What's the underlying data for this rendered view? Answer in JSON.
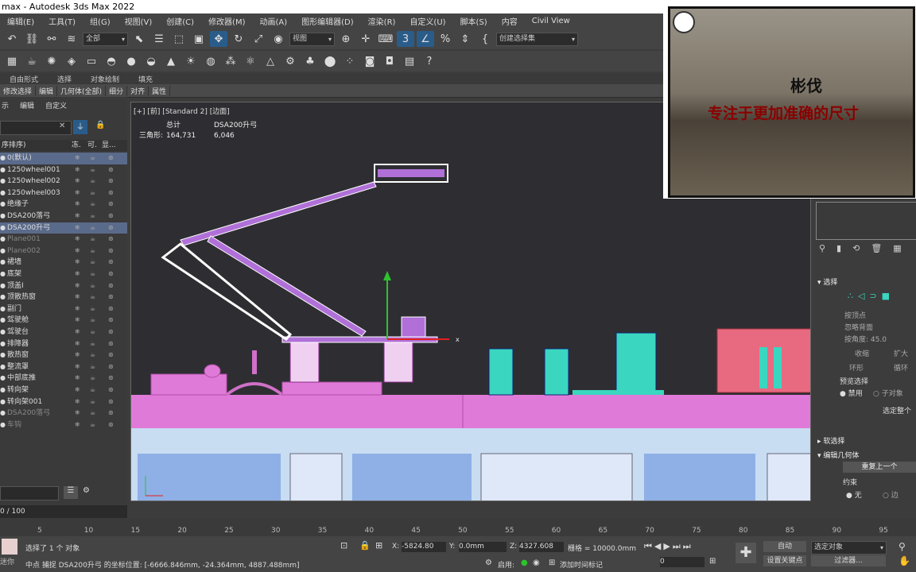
{
  "window": {
    "title": "max - Autodesk 3ds Max 2022"
  },
  "menu": [
    "编辑(E)",
    "工具(T)",
    "组(G)",
    "视图(V)",
    "创建(C)",
    "修改器(M)",
    "动画(A)",
    "图形编辑器(D)",
    "渲染(R)",
    "自定义(U)",
    "脚本(S)",
    "内容",
    "Civil View"
  ],
  "toolbar1": {
    "filter": "全部",
    "refcoord": "视图",
    "selset": "创建选择集"
  },
  "ribbon": {
    "tabs": [
      "自由形式",
      "选择",
      "对象绘制",
      "填充"
    ],
    "sub": [
      "修改选择",
      "编辑",
      "几何体(全部)",
      "细分",
      "对齐",
      "属性"
    ]
  },
  "scene": {
    "tabs": [
      "示",
      "编辑",
      "自定义"
    ],
    "col_name": "序排序)",
    "col_icons": [
      "冻.",
      "可.",
      "显..."
    ],
    "rows": [
      {
        "name": "0(默认)",
        "sel": true
      },
      {
        "name": "1250wheel001"
      },
      {
        "name": "1250wheel002"
      },
      {
        "name": "1250wheel003"
      },
      {
        "name": "绝缘子"
      },
      {
        "name": "DSA200落弓"
      },
      {
        "name": "DSA200升弓",
        "sel": true
      },
      {
        "name": "Plane001",
        "dim": true
      },
      {
        "name": "Plane002",
        "dim": true
      },
      {
        "name": "裙墙"
      },
      {
        "name": "底架"
      },
      {
        "name": "顶盖I"
      },
      {
        "name": "顶散热窗"
      },
      {
        "name": "副门"
      },
      {
        "name": "驾驶舱"
      },
      {
        "name": "驾驶台"
      },
      {
        "name": "排障器"
      },
      {
        "name": "散热窗"
      },
      {
        "name": "整流罩"
      },
      {
        "name": "中部底推"
      },
      {
        "name": "转向架"
      },
      {
        "name": "转向架001"
      },
      {
        "name": "DSA200落弓",
        "dim": true
      },
      {
        "name": "车钩",
        "dim": true
      }
    ],
    "frame": "0 / 100",
    "selected_label": "选择了 1 个 对象",
    "mini": "迷你"
  },
  "viewport": {
    "label": "[+] [前] [Standard 2] [边面]",
    "stats_header_total": "总计",
    "stats_header_obj": "DSA200升弓",
    "stats_label": "三角形:",
    "stats_total": "164,731",
    "stats_obj": "6,046"
  },
  "timeline": {
    "ticks": [
      "5",
      "10",
      "15",
      "20",
      "25",
      "30",
      "35",
      "40",
      "45",
      "50",
      "55",
      "60",
      "65",
      "70",
      "75",
      "80",
      "85",
      "90",
      "95"
    ]
  },
  "status": {
    "prompt": "中点  捕捉 DSA200升弓 的坐标位置: [-6666.846mm, -24.364mm, 4887.488mm]",
    "x_label": "X:",
    "x": "-5824.80",
    "y_label": "Y:",
    "y": "0.0mm",
    "z_label": "Z:",
    "z": "4327.608",
    "grid": "栅格 = 10000.0mm",
    "enable": "启用:",
    "addtime": "添加时间标记",
    "auto": "自动",
    "set_key": "设置关键点",
    "sel_obj": "选定对象",
    "filter": "过滤器...",
    "frame_val": "0"
  },
  "cmdpanel": {
    "selection": "选择",
    "opts": [
      "按顶点",
      "忽略背面",
      "按角度: 45.0"
    ],
    "btns": [
      "收缩",
      "扩大",
      "环形",
      "循环"
    ],
    "preview": "预览选择",
    "disable": "禁用",
    "subobj": "子对象",
    "selall": "选定整个",
    "soft": "软选择",
    "editgeo": "编辑几何体",
    "repeat": "重复上一个",
    "constraint": "约束",
    "none": "无",
    "edge": "边"
  },
  "overlay": {
    "title": "彬伐",
    "subtitle": "专注于更加准确的尺寸"
  }
}
